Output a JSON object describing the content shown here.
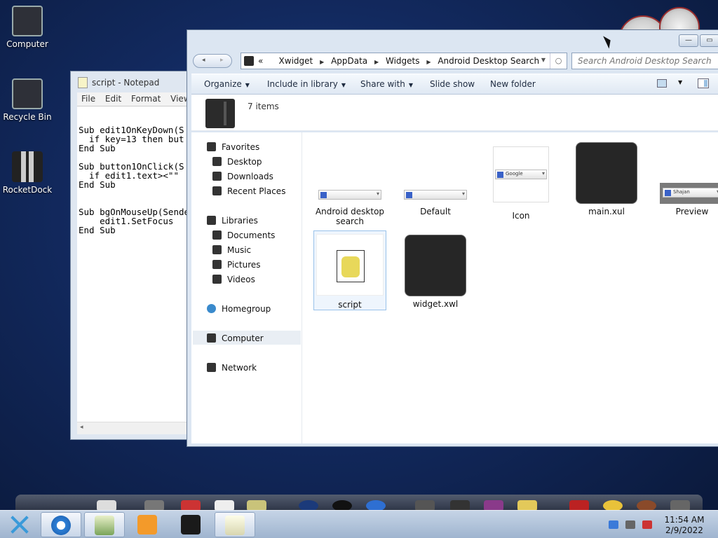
{
  "desktop": {
    "icons": [
      {
        "label": "Computer"
      },
      {
        "label": "Recycle Bin"
      },
      {
        "label": "RocketDock"
      }
    ]
  },
  "notepad": {
    "title": "script - Notepad",
    "menu": [
      "File",
      "Edit",
      "Format",
      "View"
    ],
    "text": "Sub edit1OnKeyDown(S\n  if key=13 then but\nEnd Sub\n\nSub button1OnClick(S\n  if edit1.text><\"\"\nEnd Sub\n\n\nSub bgOnMouseUp(Sende\n    edit1.SetFocus\nEnd Sub",
    "scroll_arrow": "◂"
  },
  "explorer": {
    "back_glyph": "◂",
    "forward_glyph": "▸",
    "breadcrumb": [
      "Xwidget",
      "AppData",
      "Widgets",
      "Android Desktop Search"
    ],
    "breadcrumb_prefix": "«",
    "search_placeholder": "Search Android Desktop Search",
    "toolbar": {
      "organize": "Organize",
      "include_in_library": "Include in library",
      "share_with": "Share with",
      "slide_show": "Slide show",
      "new_folder": "New folder"
    },
    "item_count": "7 items",
    "nav": {
      "favorites": "Favorites",
      "desktop": "Desktop",
      "downloads": "Downloads",
      "recent_places": "Recent Places",
      "libraries": "Libraries",
      "documents": "Documents",
      "music": "Music",
      "pictures": "Pictures",
      "videos": "Videos",
      "homegroup": "Homegroup",
      "computer": "Computer",
      "network": "Network"
    },
    "files": {
      "f1": "Android desktop search",
      "f2": "Default",
      "f3": "Icon",
      "f4": "main.xul",
      "f5": "Preview",
      "f6": "script",
      "f7": "widget.xwl"
    },
    "thumb_text": {
      "icon": "Google",
      "preview": "Shajan"
    }
  },
  "taskbar": {
    "time": "11:54 AM",
    "date": "2/9/2022"
  },
  "colors": {
    "desktop_bg": "#12295e",
    "taskbar": "#b3c4db",
    "selection": "#99c2ea"
  }
}
